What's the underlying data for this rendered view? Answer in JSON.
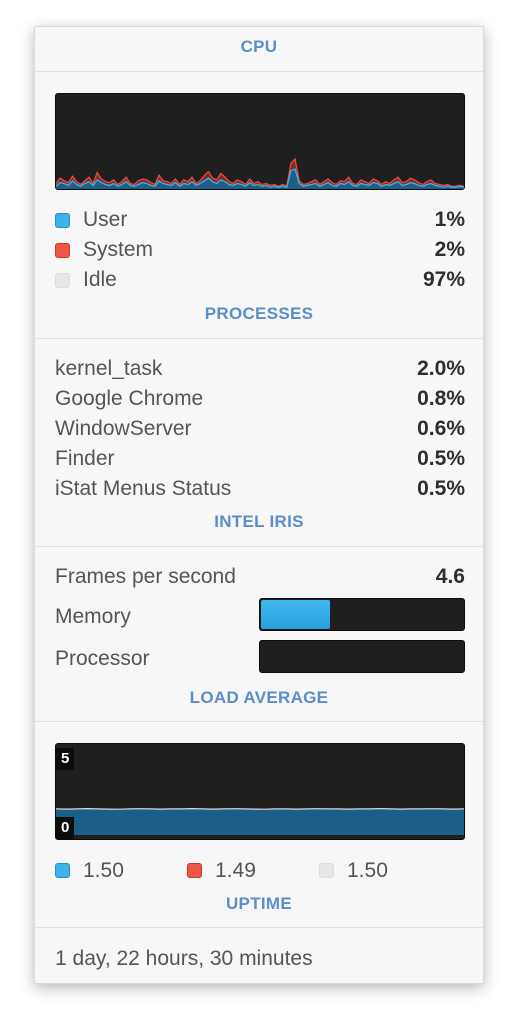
{
  "cpu": {
    "header": "CPU",
    "legend": [
      {
        "name": "User",
        "value": "1%",
        "color": "#3db3ea"
      },
      {
        "name": "System",
        "value": "2%",
        "color": "#ee5746"
      },
      {
        "name": "Idle",
        "value": "97%",
        "color": "#e7e7e7"
      }
    ],
    "graph": {
      "user_series": [
        3,
        7,
        6,
        4,
        9,
        5,
        3,
        6,
        8,
        4,
        10,
        7,
        5,
        4,
        6,
        3,
        5,
        8,
        4,
        3,
        5,
        7,
        6,
        4,
        3,
        9,
        6,
        5,
        4,
        7,
        3,
        6,
        5,
        8,
        4,
        6,
        9,
        12,
        8,
        6,
        10,
        8,
        5,
        4,
        6,
        5,
        3,
        7,
        4,
        5,
        3,
        4,
        2,
        3,
        2,
        3,
        2,
        20,
        22,
        6,
        3,
        4,
        5,
        6,
        3,
        5,
        7,
        4,
        3,
        6,
        5,
        8,
        4,
        3,
        6,
        5,
        4,
        7,
        6,
        3,
        5,
        4,
        6,
        8,
        4,
        5,
        7,
        6,
        4,
        3,
        5,
        6,
        4,
        3,
        2,
        3,
        2,
        2,
        3,
        2
      ],
      "system_series": [
        6,
        12,
        9,
        7,
        14,
        8,
        5,
        9,
        13,
        6,
        18,
        11,
        8,
        7,
        10,
        5,
        8,
        13,
        6,
        5,
        9,
        11,
        10,
        7,
        5,
        15,
        9,
        8,
        6,
        11,
        5,
        10,
        8,
        13,
        6,
        9,
        15,
        19,
        12,
        10,
        17,
        13,
        8,
        6,
        10,
        8,
        5,
        11,
        6,
        8,
        5,
        6,
        4,
        5,
        3,
        5,
        3,
        28,
        33,
        9,
        5,
        6,
        8,
        10,
        5,
        8,
        11,
        7,
        5,
        9,
        8,
        13,
        6,
        5,
        10,
        8,
        6,
        11,
        9,
        5,
        8,
        6,
        10,
        13,
        7,
        8,
        12,
        10,
        7,
        5,
        8,
        10,
        6,
        5,
        4,
        5,
        3,
        3,
        4,
        3
      ],
      "max": 100
    }
  },
  "processes": {
    "header": "PROCESSES",
    "items": [
      {
        "name": "kernel_task",
        "value": "2.0%"
      },
      {
        "name": "Google Chrome",
        "value": "0.8%"
      },
      {
        "name": "WindowServer",
        "value": "0.6%"
      },
      {
        "name": "Finder",
        "value": "0.5%"
      },
      {
        "name": "iStat Menus Status",
        "value": "0.5%"
      }
    ]
  },
  "gpu": {
    "header": "INTEL IRIS",
    "fps_label": "Frames per second",
    "fps_value": "4.6",
    "memory_label": "Memory",
    "memory_fraction": 0.34,
    "processor_label": "Processor",
    "processor_fraction": 0.0
  },
  "load": {
    "header": "LOAD AVERAGE",
    "scale_max_label": "5",
    "scale_min_label": "0",
    "scale_max": 5,
    "series": [
      1.5,
      1.49,
      1.5,
      1.52,
      1.5,
      1.49,
      1.48,
      1.5,
      1.51,
      1.5,
      1.49,
      1.5,
      1.5,
      1.52,
      1.5,
      1.49,
      1.5,
      1.51,
      1.5,
      1.49,
      1.48,
      1.5,
      1.5,
      1.49,
      1.5,
      1.51,
      1.5,
      1.5,
      1.49,
      1.5,
      1.5,
      1.52,
      1.5,
      1.49,
      1.5,
      1.5,
      1.51,
      1.5,
      1.49,
      1.5
    ],
    "legend": [
      {
        "value": "1.50",
        "color": "#3db3ea"
      },
      {
        "value": "1.49",
        "color": "#ee5746"
      },
      {
        "value": "1.50",
        "color": "#e7e7e7"
      }
    ]
  },
  "uptime": {
    "header": "UPTIME",
    "value": "1 day, 22 hours, 30 minutes"
  }
}
